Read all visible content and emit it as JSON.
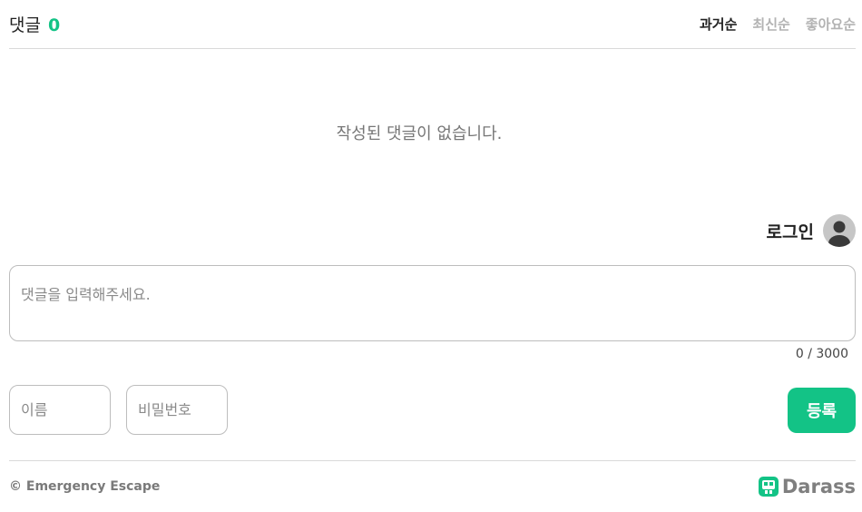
{
  "header": {
    "title": "댓글",
    "count": "0",
    "sort_tabs": [
      "과거순",
      "최신순",
      "좋아요순"
    ]
  },
  "empty_message": "작성된 댓글이 없습니다.",
  "login": {
    "label": "로그인",
    "avatar_icon": "user-avatar-icon"
  },
  "comment": {
    "placeholder": "댓글을 입력해주세요.",
    "value": "",
    "char_count": "0 / 3000"
  },
  "form": {
    "name_placeholder": "이름",
    "password_placeholder": "비밀번호",
    "submit_label": "등록"
  },
  "footer": {
    "copyright": "© Emergency Escape",
    "brand": "Darass",
    "brand_icon": "darass-logo-icon"
  },
  "colors": {
    "accent": "#13c386",
    "text_dark": "#222222",
    "text_muted": "#b3b3b3",
    "border": "#bdbdbd"
  }
}
